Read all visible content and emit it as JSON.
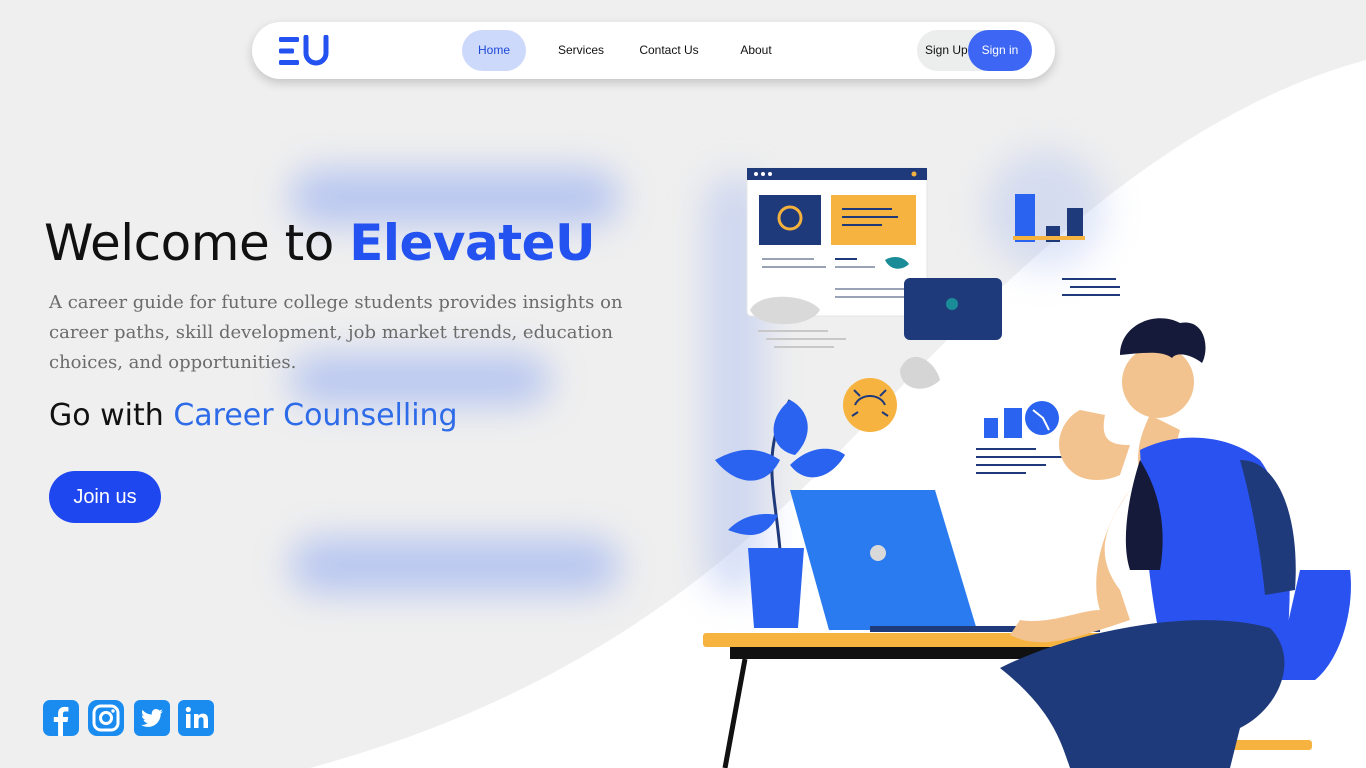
{
  "brand": {
    "logo_text": "EU",
    "color": "#2352f0"
  },
  "nav": {
    "items": [
      {
        "label": "Home",
        "active": true
      },
      {
        "label": "Services",
        "active": false
      },
      {
        "label": "Contact Us",
        "active": false
      },
      {
        "label": "About",
        "active": false
      }
    ],
    "signup_label": "Sign Up",
    "signin_label": "Sign in"
  },
  "hero": {
    "title_prefix": "Welcome to ",
    "title_brand": "ElevateU",
    "description": "A career guide for future college students provides insights on career paths, skill development, job market trends, education choices, and opportunities.",
    "sub_prefix": "Go with ",
    "sub_accent": "Career Counselling",
    "cta_label": "Join us"
  },
  "socials": [
    {
      "icon": "facebook-icon"
    },
    {
      "icon": "instagram-icon"
    },
    {
      "icon": "twitter-icon"
    },
    {
      "icon": "linkedin-icon"
    }
  ],
  "colors": {
    "primary": "#1f47f0",
    "accent": "#2d6be8",
    "active_tab_bg": "#cdd9fb",
    "background": "#efefef"
  }
}
